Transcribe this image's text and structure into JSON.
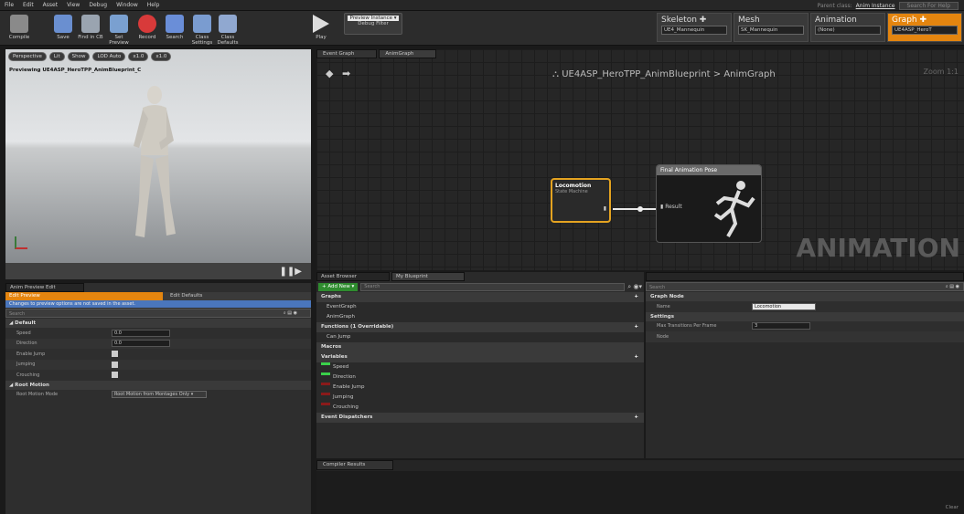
{
  "menu": [
    "File",
    "Edit",
    "Asset",
    "View",
    "Debug",
    "Window",
    "Help"
  ],
  "parent_class": {
    "label": "Parent class:",
    "value": "Anim Instance",
    "search": "Search For Help"
  },
  "toolbar": [
    {
      "label": "Compile",
      "icon": "compile-icon",
      "color": "#8a8a8a"
    },
    {
      "label": "Save",
      "icon": "save-icon",
      "color": "#6a8fd0"
    },
    {
      "label": "Find in CB",
      "icon": "find-icon",
      "color": "#9aa4b0"
    },
    {
      "label": "Set Preview",
      "icon": "preview-icon",
      "color": "#7aa0d0"
    },
    {
      "label": "Record",
      "icon": "record-icon",
      "color": "#d83a3a"
    },
    {
      "label": "Search",
      "icon": "search-icon",
      "color": "#6a8ed8"
    },
    {
      "label": "Class Settings",
      "icon": "settings-icon",
      "color": "#7a9cd0"
    },
    {
      "label": "Class Defaults",
      "icon": "defaults-icon",
      "color": "#90a8d0"
    },
    {
      "label": "Play",
      "icon": "play-icon",
      "color": "#dddddd"
    }
  ],
  "preview_instance": {
    "label": "Preview Instance ▾",
    "sub": "Debug Filter"
  },
  "modes": [
    {
      "name": "Skeleton ✚",
      "asset": "UE4_Mannequin"
    },
    {
      "name": "Mesh",
      "asset": "SK_Mannequin"
    },
    {
      "name": "Animation",
      "asset": "(None)"
    },
    {
      "name": "Graph ✚",
      "asset": "UE4ASP_HeroT"
    }
  ],
  "viewport": {
    "buttons": [
      "Perspective",
      "Lit",
      "Show",
      "LOD Auto",
      "x1.0",
      "x1.0"
    ],
    "label": "Previewing UE4ASP_HeroTPP_AnimBlueprint_C"
  },
  "left_panel": {
    "tab": "Anim Preview Edit",
    "edit_preview": "Edit Preview",
    "edit_defaults": "Edit Defaults",
    "info": "Changes to preview options are not saved in the asset.",
    "search": "Search",
    "default_section": "Default",
    "rows": [
      {
        "label": "Speed",
        "value": "0.0",
        "type": "num"
      },
      {
        "label": "Direction",
        "value": "0.0",
        "type": "num"
      },
      {
        "label": "Enable Jump",
        "type": "check"
      },
      {
        "label": "Jumping",
        "type": "check"
      },
      {
        "label": "Crouching",
        "type": "check"
      }
    ],
    "root_section": "Root Motion",
    "root_label": "Root Motion Mode",
    "root_value": "Root Motion from Montages Only ▾"
  },
  "graph": {
    "tabs": [
      "Event Graph",
      "AnimGraph"
    ],
    "breadcrumb": "UE4ASP_HeroTPP_AnimBlueprint > AnimGraph",
    "zoom": "Zoom 1:1",
    "watermark": "ANIMATION",
    "loco_title": "Locomotion",
    "loco_sub": "State Machine",
    "final_title": "Final Animation Pose",
    "result": "Result"
  },
  "my_blueprint": {
    "tabs": [
      "Asset Browser",
      "My Blueprint"
    ],
    "add_new": "+ Add New ▾",
    "search": "Search",
    "rows": [
      {
        "text": "Graphs",
        "sec": true
      },
      {
        "text": "EventGraph"
      },
      {
        "text": "AnimGraph"
      },
      {
        "text": "Functions (1 Overridable)",
        "sec": true
      },
      {
        "text": "Can Jump"
      },
      {
        "text": "Macros",
        "sec": true
      },
      {
        "text": "Variables",
        "sec": true
      },
      {
        "text": "Speed"
      },
      {
        "text": "Direction"
      },
      {
        "text": "Enable Jump"
      },
      {
        "text": "Jumping"
      },
      {
        "text": "Crouching"
      },
      {
        "text": "Event Dispatchers",
        "sec": true
      }
    ]
  },
  "details": {
    "search": "Search",
    "graph_node": "Graph Node",
    "name_label": "Name",
    "name_value": "Locomotion",
    "settings": "Settings",
    "max_label": "Max Transitions Per Frame",
    "max_value": "3",
    "node_label": "Node"
  },
  "compiler": {
    "tab": "Compiler Results",
    "footer": "Clear"
  }
}
